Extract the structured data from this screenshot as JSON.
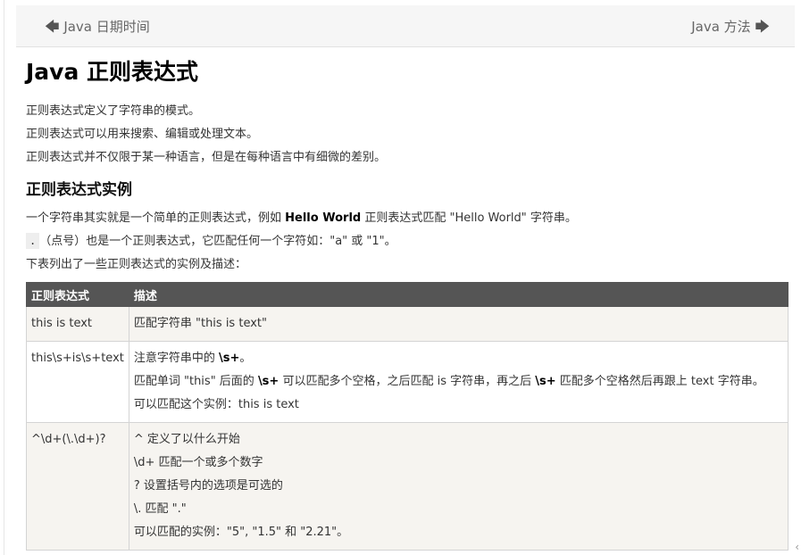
{
  "nav": {
    "prev_label": "Java 日期时间",
    "next_label": "Java 方法"
  },
  "article": {
    "title": "Java 正则表达式",
    "intro": [
      "正则表达式定义了字符串的模式。",
      "正则表达式可以用来搜索、编辑或处理文本。",
      "正则表达式并不仅限于某一种语言，但是在每种语言中有细微的差别。"
    ],
    "section_title": "正则表达式实例",
    "example": {
      "prefix": "一个字符串其实就是一个简单的正则表达式，例如",
      "bold": "Hello World",
      "suffix": "正则表达式匹配 \"Hello World\" 字符串。"
    },
    "dot": {
      "code": ".",
      "text": "（点号）也是一个正则表达式，它匹配任何一个字符如：\"a\" 或 \"1\"。"
    },
    "table_intro": "下表列出了一些正则表达式的实例及描述："
  },
  "table": {
    "headers": [
      "正则表达式",
      "描述"
    ],
    "rows": [
      {
        "pattern": "this is text",
        "lines": [
          "匹配字符串 \"this is text\""
        ]
      },
      {
        "pattern": "this\\s+is\\s+text",
        "l1_pre": "注意字符串中的 ",
        "l1_bold": "\\s+",
        "l1_post": "。",
        "l2_pre": "匹配单词 \"this\" 后面的 ",
        "l2_bold1": "\\s+",
        "l2_mid": " 可以匹配多个空格，之后匹配 is 字符串，再之后 ",
        "l2_bold2": "\\s+",
        "l2_post": " 匹配多个空格然后再跟上 text 字符串。",
        "l3": "可以匹配这个实例：this is text"
      },
      {
        "pattern": "^\\d+(\\.\\d+)?",
        "lines": [
          "^ 定义了以什么开始",
          "\\d+ 匹配一个或多个数字",
          "? 设置括号内的选项是可选的",
          "\\. 匹配 \".\"",
          "可以匹配的实例：\"5\", \"1.5\" 和 \"2.21\"。"
        ]
      }
    ]
  },
  "icons": {
    "prev": "arrow-left-icon",
    "next": "arrow-right-icon",
    "scroll": "chevron-left-icon"
  }
}
